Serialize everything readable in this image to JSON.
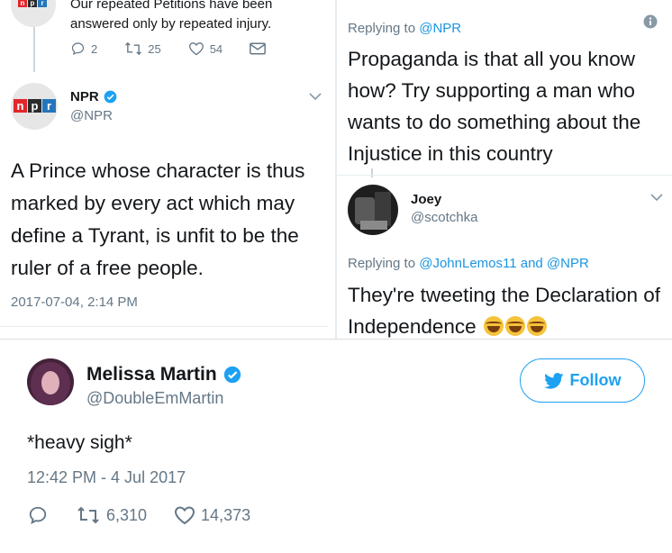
{
  "top_left": {
    "prev_tweet_text": "Our repeated Petitions have been answered only by repeated injury.",
    "prev_counts": {
      "reply": "2",
      "retweet": "25",
      "like": "54"
    },
    "npr_logo": [
      "n",
      "p",
      "r"
    ],
    "author_name": "NPR",
    "author_handle": "@NPR",
    "tweet_text": "A Prince whose character is thus marked by every act which may define a Tyrant, is unfit to be the ruler of a free people.",
    "timestamp": "2017-07-04, 2:14 PM"
  },
  "top_right": {
    "reply1_prefix": "Replying to ",
    "reply1_target": "@NPR",
    "reply1_text": "Propaganda is that all you know how? Try supporting a man who wants to do something about the Injustice in this country",
    "joey_name": "Joey",
    "joey_handle": "@scotchka",
    "reply2_prefix": "Replying to ",
    "reply2_target": "@JohnLemos11 and @NPR",
    "reply2_text": "They're tweeting the Declaration of Independence"
  },
  "main_tweet": {
    "author_name": "Melissa Martin",
    "author_handle": "@DoubleEmMartin",
    "follow_label": "Follow",
    "text": "*heavy sigh*",
    "timestamp": "12:42 PM - 4 Jul 2017",
    "retweet_count": "6,310",
    "like_count": "14,373"
  },
  "colors": {
    "accent": "#1da1f2",
    "link": "#1b95e0",
    "muted": "#657786",
    "text": "#14171a"
  },
  "icons": [
    "reply-icon",
    "retweet-icon",
    "heart-icon",
    "mail-icon",
    "verified-icon",
    "chevron-down-icon",
    "info-icon",
    "twitter-bird-icon",
    "laughing-emoji-icon"
  ]
}
